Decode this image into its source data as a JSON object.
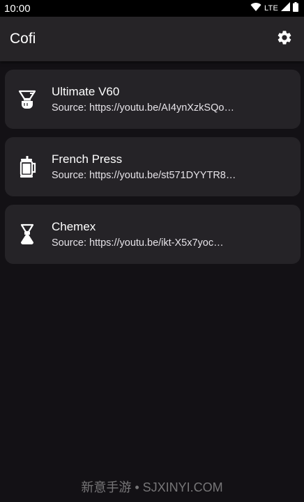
{
  "status_bar": {
    "time": "10:00",
    "network": "LTE",
    "icons": [
      "wifi-icon",
      "signal-icon",
      "battery-icon"
    ]
  },
  "app_bar": {
    "title": "Cofi",
    "settings_icon": "gear-icon"
  },
  "recipes": [
    {
      "title": "Ultimate V60",
      "source": "Source: https://youtu.be/AI4ynXzkSQo…",
      "icon": "v60-dripper-icon"
    },
    {
      "title": "French Press",
      "source": "Source: https://youtu.be/st571DYYTR8…",
      "icon": "french-press-icon"
    },
    {
      "title": "Chemex",
      "source": "Source: https://youtu.be/ikt-X5x7yoc…",
      "icon": "chemex-icon"
    }
  ],
  "watermark": "新意手游 • SJXINYI.COM",
  "colors": {
    "background": "#131115",
    "app_bar": "#262427",
    "card": "#252327",
    "text": "#ffffff"
  }
}
